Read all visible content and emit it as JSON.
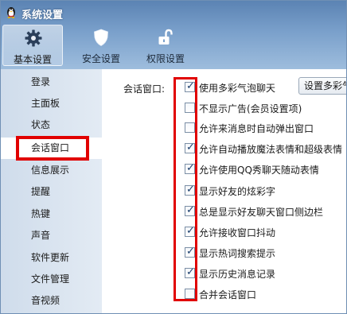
{
  "window": {
    "title": "系统设置",
    "app_icon": "penguin-icon"
  },
  "toolbar": {
    "tabs": [
      {
        "label": "基本设置",
        "icon": "gear-icon",
        "selected": true
      },
      {
        "label": "安全设置",
        "icon": "shield-icon",
        "selected": false
      },
      {
        "label": "权限设置",
        "icon": "unlock-icon",
        "selected": false
      }
    ]
  },
  "sidebar": {
    "items": [
      {
        "label": "登录"
      },
      {
        "label": "主面板"
      },
      {
        "label": "状态"
      },
      {
        "label": "会话窗口",
        "active": true
      },
      {
        "label": "信息展示"
      },
      {
        "label": "提醒"
      },
      {
        "label": "热键"
      },
      {
        "label": "声音"
      },
      {
        "label": "软件更新"
      },
      {
        "label": "文件管理"
      },
      {
        "label": "音视频"
      }
    ]
  },
  "main": {
    "section_label": "会话窗口:",
    "bubble_button_label": "设置多彩气",
    "options": [
      {
        "label": "使用多彩气泡聊天",
        "checked": true
      },
      {
        "label": "不显示广告(会员设置项)",
        "checked": false
      },
      {
        "label": "允许来消息时自动弹出窗口",
        "checked": false
      },
      {
        "label": "允许自动播放魔法表情和超级表情",
        "checked": true
      },
      {
        "label": "允许使用QQ秀聊天随动表情",
        "checked": true
      },
      {
        "label": "显示好友的炫彩字",
        "checked": true
      },
      {
        "label": "总是显示好友聊天窗口侧边栏",
        "checked": true
      },
      {
        "label": "允许接收窗口抖动",
        "checked": true
      },
      {
        "label": "显示热词搜索提示",
        "checked": true
      },
      {
        "label": "显示历史消息记录",
        "checked": true
      },
      {
        "label": "合并会话窗口",
        "checked": false
      }
    ]
  },
  "colors": {
    "highlight_box": "#e10000",
    "header_blue": "#5b83b3",
    "sidebar_bg": "#d6e2ee"
  }
}
